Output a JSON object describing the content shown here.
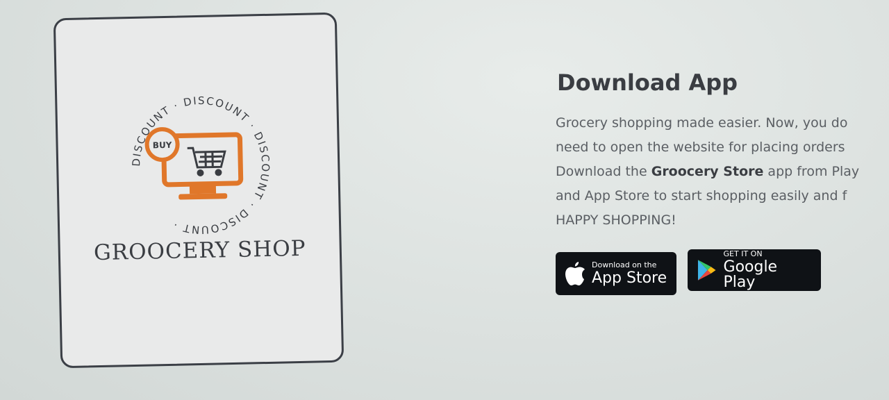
{
  "logo": {
    "ring_text": "DISCOUNT · DISCOUNT · DISCOUNT · DISCOUNT ·",
    "buy_label": "BUY",
    "shop_name": "GROOCERY SHOP",
    "accent_color": "#e0772a"
  },
  "download": {
    "title": "Download App",
    "desc": {
      "line1": "Grocery shopping made easier. Now, you do",
      "line2": "need to open the website for placing orders",
      "line3_pre": "Download the ",
      "line3_bold": "Groocery Store",
      "line3_post": " app from Play",
      "line4": "and App Store to start shopping easily and f",
      "line5": "HAPPY SHOPPING!"
    }
  },
  "stores": {
    "app_store": {
      "small": "Download on the",
      "big": "App Store",
      "icon": "apple-icon"
    },
    "google_play": {
      "small": "GET IT ON",
      "big": "Google Play",
      "icon": "google-play-icon"
    }
  }
}
